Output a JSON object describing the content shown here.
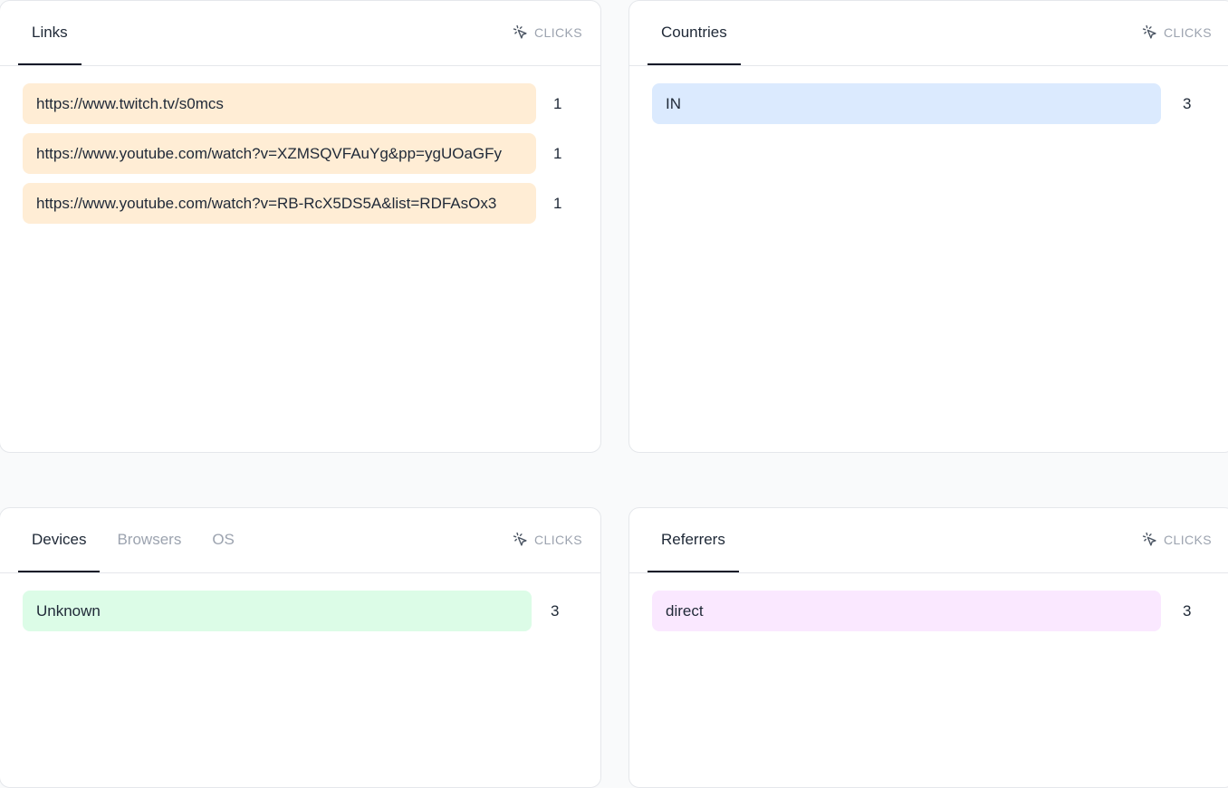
{
  "clicks_label": "CLICKS",
  "links_card": {
    "tabs": [
      "Links"
    ],
    "rows": [
      {
        "label": "https://www.twitch.tv/s0mcs",
        "count": "1"
      },
      {
        "label": "https://www.youtube.com/watch?v=XZMSQVFAuYg&pp=ygUOaGFy",
        "count": "1"
      },
      {
        "label": "https://www.youtube.com/watch?v=RB-RcX5DS5A&list=RDFAsOx3",
        "count": "1"
      }
    ],
    "bar_color": "#ffedd5"
  },
  "countries_card": {
    "tabs": [
      "Countries"
    ],
    "rows": [
      {
        "label": "IN",
        "count": "3"
      }
    ],
    "bar_color": "#dbeafe"
  },
  "devices_card": {
    "tabs": [
      "Devices",
      "Browsers",
      "OS"
    ],
    "active_tab": "Devices",
    "rows": [
      {
        "label": "Unknown",
        "count": "3"
      }
    ],
    "bar_color": "#dcfce7"
  },
  "referrers_card": {
    "tabs": [
      "Referrers"
    ],
    "rows": [
      {
        "label": "direct",
        "count": "3"
      }
    ],
    "bar_color": "#fae8ff"
  },
  "icons": {
    "clicks": "cursor-click-icon"
  }
}
